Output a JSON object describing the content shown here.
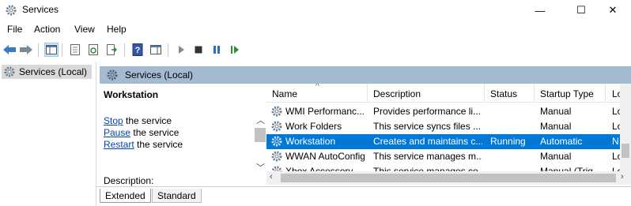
{
  "window": {
    "title": "Services",
    "minimize": "—",
    "maximize": "☐",
    "close": "✕"
  },
  "menu": [
    "File",
    "Action",
    "View",
    "Help"
  ],
  "tree": {
    "root": "Services (Local)"
  },
  "band": {
    "label": "Services (Local)"
  },
  "detail": {
    "service_name": "Workstation",
    "actions": [
      {
        "link": "Stop",
        "rest": " the service"
      },
      {
        "link": "Pause",
        "rest": " the service"
      },
      {
        "link": "Restart",
        "rest": " the service"
      }
    ],
    "description_label": "Description:"
  },
  "list": {
    "columns": [
      "Name",
      "Description",
      "Status",
      "Startup Type",
      "Lo"
    ],
    "rows": [
      {
        "name": "WMI Performanc...",
        "description": "Provides performance li...",
        "status": "",
        "startup": "Manual",
        "logon": "Lo",
        "selected": false
      },
      {
        "name": "Work Folders",
        "description": "This service syncs files ...",
        "status": "",
        "startup": "Manual",
        "logon": "Lo",
        "selected": false
      },
      {
        "name": "Workstation",
        "description": "Creates and maintains c...",
        "status": "Running",
        "startup": "Automatic",
        "logon": "N",
        "selected": true
      },
      {
        "name": "WWAN AutoConfig",
        "description": "This service manages m...",
        "status": "",
        "startup": "Manual",
        "logon": "Lo",
        "selected": false
      },
      {
        "name": "Xbox Accessory ...",
        "description": "This service manages co...",
        "status": "",
        "startup": "Manual (Trig...",
        "logon": "Lo",
        "selected": false
      }
    ]
  },
  "tabs": [
    "Extended",
    "Standard"
  ],
  "colors": {
    "selection": "#0078d7",
    "band": "#a3bad1",
    "link": "#0645ad"
  }
}
